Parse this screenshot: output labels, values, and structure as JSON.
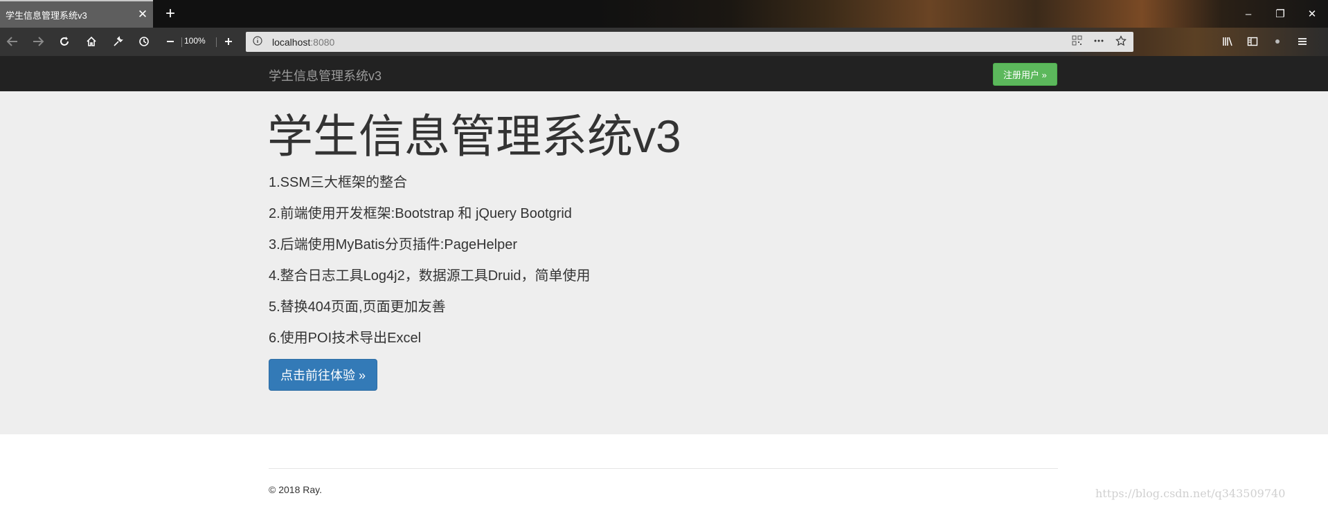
{
  "browser": {
    "tab_title": "学生信息管理系统v3",
    "tab_close": "✕",
    "new_tab": "+",
    "zoom_level": "100%",
    "url_host": "localhost",
    "url_port": ":8080",
    "window_controls": {
      "minimize": "–",
      "restore": "❐",
      "close": "✕"
    }
  },
  "site": {
    "brand": "学生信息管理系统v3",
    "register_button": "注册用户 »",
    "heading": "学生信息管理系统v3",
    "features": [
      "1.SSM三大框架的整合",
      "2.前端使用开发框架:Bootstrap 和 jQuery Bootgrid",
      "3.后端使用MyBatis分页插件:PageHelper",
      "4.整合日志工具Log4j2，数据源工具Druid，简单使用",
      "5.替换404页面,页面更加友善",
      "6.使用POI技术导出Excel"
    ],
    "cta_button": "点击前往体验 »",
    "footer": "© 2018 Ray.",
    "watermark": "https://blog.csdn.net/q343509740"
  },
  "colors": {
    "navbar": "#222222",
    "jumbotron": "#eeeeee",
    "success": "#5cb85c",
    "primary": "#337ab7"
  }
}
